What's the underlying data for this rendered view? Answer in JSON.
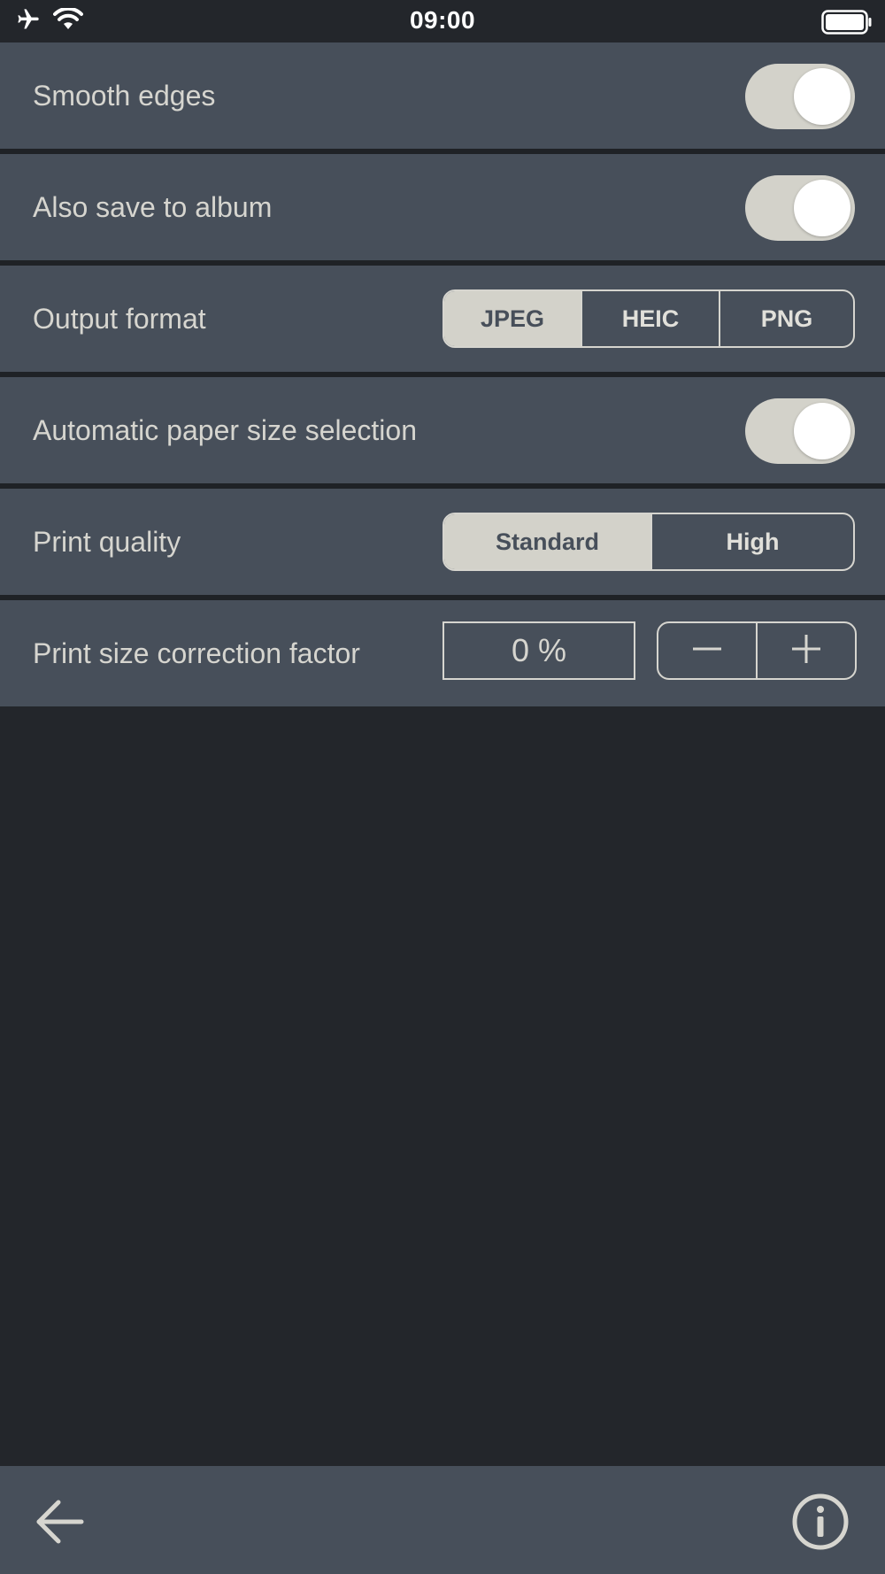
{
  "status_bar": {
    "time": "09:00",
    "icons": [
      "airplane-icon",
      "wifi-icon",
      "battery-icon"
    ]
  },
  "settings": {
    "smooth_edges": {
      "label": "Smooth edges",
      "enabled": true
    },
    "save_to_album": {
      "label": "Also save to album",
      "enabled": true
    },
    "output_format": {
      "label": "Output format",
      "options": [
        "JPEG",
        "HEIC",
        "PNG"
      ],
      "selected": "JPEG"
    },
    "auto_paper_size": {
      "label": "Automatic paper size selection",
      "enabled": true
    },
    "print_quality": {
      "label": "Print quality",
      "options": [
        "Standard",
        "High"
      ],
      "selected": "Standard"
    },
    "correction_factor": {
      "label": "Print size correction factor",
      "value": "0 %"
    }
  },
  "bottom_bar": {
    "icons": [
      "back-arrow-icon",
      "info-icon"
    ]
  },
  "colors": {
    "background": "#23262b",
    "row": "#474f5a",
    "accent": "#d3d2ca",
    "text": "#d6d5cf"
  }
}
